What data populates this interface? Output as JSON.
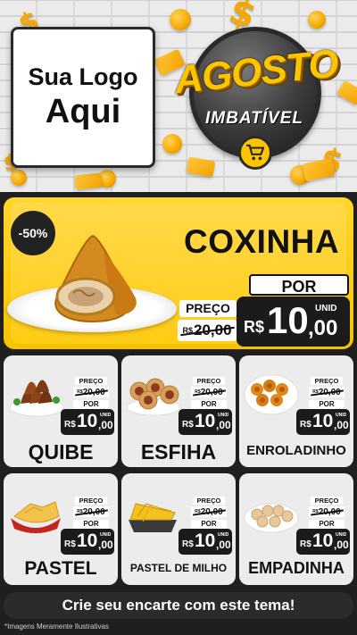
{
  "header": {
    "logo_line1": "Sua Logo",
    "logo_line2": "Aqui",
    "badge_title": "AGOSTO",
    "badge_subtitle": "IMBATÍVEL",
    "badge_icon": "shopping-cart-icon"
  },
  "featured": {
    "discount": "-50%",
    "name": "COXINHA",
    "preco_label": "PREÇO",
    "old_currency": "R$",
    "old_price": "20,00",
    "por_label": "POR",
    "unit_label": "UNID",
    "currency": "R$",
    "price_int": "10",
    "price_dec": ",00"
  },
  "products": [
    {
      "name": "QUIBE",
      "preco_label": "PREÇO",
      "old_currency": "R$",
      "old_price": "20,00",
      "por_label": "POR",
      "unit_label": "UNID",
      "currency": "R$",
      "price_int": "10",
      "price_dec": ",00"
    },
    {
      "name": "ESFIHA",
      "preco_label": "PREÇO",
      "old_currency": "R$",
      "old_price": "20,00",
      "por_label": "POR",
      "unit_label": "UNID",
      "currency": "R$",
      "price_int": "10",
      "price_dec": ",00"
    },
    {
      "name": "ENROLADINHO",
      "preco_label": "PREÇO",
      "old_currency": "R$",
      "old_price": "20,00",
      "por_label": "POR",
      "unit_label": "UNID",
      "currency": "R$",
      "price_int": "10",
      "price_dec": ",00"
    },
    {
      "name": "PASTEL",
      "preco_label": "PREÇO",
      "old_currency": "R$",
      "old_price": "20,00",
      "por_label": "POR",
      "unit_label": "UNID",
      "currency": "R$",
      "price_int": "10",
      "price_dec": ",00"
    },
    {
      "name": "PASTEL DE MILHO",
      "preco_label": "PREÇO",
      "old_currency": "R$",
      "old_price": "20,00",
      "por_label": "POR",
      "unit_label": "UNID",
      "currency": "R$",
      "price_int": "10",
      "price_dec": ",00"
    },
    {
      "name": "EMPADINHA",
      "preco_label": "PREÇO",
      "old_currency": "R$",
      "old_price": "20,00",
      "por_label": "POR",
      "unit_label": "UNID",
      "currency": "R$",
      "price_int": "10",
      "price_dec": ",00"
    }
  ],
  "banner": {
    "text": "Crie seu encarte com este tema!"
  },
  "footnote": "*Imagens Meramente Ilustrativas",
  "colors": {
    "accent": "#ffc400",
    "dark": "#1b1b1b",
    "card": "#ececec",
    "background": "#1f1f1f"
  }
}
